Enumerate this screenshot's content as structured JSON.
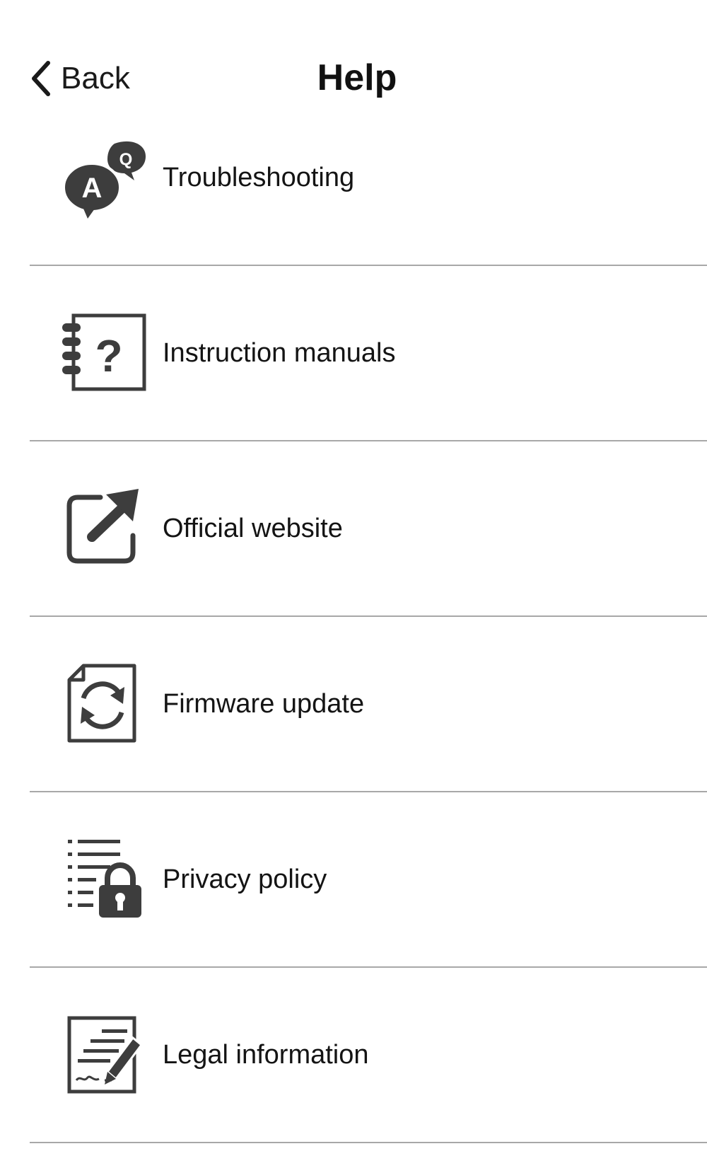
{
  "header": {
    "back_label": "Back",
    "title": "Help"
  },
  "menu": {
    "items": [
      {
        "label": "Troubleshooting",
        "icon": "question-answer-bubbles-icon"
      },
      {
        "label": "Instruction manuals",
        "icon": "manual-question-icon"
      },
      {
        "label": "Official website",
        "icon": "external-link-icon"
      },
      {
        "label": "Firmware update",
        "icon": "firmware-update-icon"
      },
      {
        "label": "Privacy policy",
        "icon": "privacy-lock-icon"
      },
      {
        "label": "Legal information",
        "icon": "legal-document-icon"
      }
    ]
  },
  "colors": {
    "text": "#141414",
    "icon": "#3d3d3d",
    "divider": "#a8a8a8",
    "background": "#ffffff"
  }
}
